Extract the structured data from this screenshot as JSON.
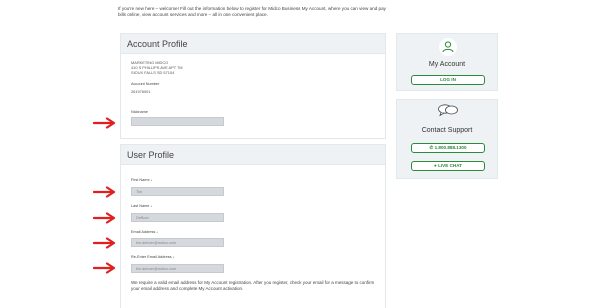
{
  "intro": "If you're new here – welcome! Fill out the information below to register for Midco Business My Account, where you can view and pay bills online, view account services and more – all in one convenient place.",
  "account_profile": {
    "title": "Account Profile",
    "address_lines": [
      "MARKETING MIDCO",
      "410 S PHILLIPS AVE APT 7M",
      "SIOUX FALLS SD 57104"
    ],
    "account_number_label": "Account Number",
    "account_number": "261976001",
    "nickname_label": "Nickname",
    "nickname_value": ""
  },
  "user_profile": {
    "title": "User Profile",
    "fields": [
      {
        "label": "First Name",
        "value": "Tim"
      },
      {
        "label": "Last Name",
        "value": "DeBoer"
      },
      {
        "label": "Email Address",
        "value": "tim.deboer@midco.com"
      },
      {
        "label": "Re-Enter Email Address",
        "value": "tim.deboer@midco.com"
      }
    ],
    "required_mark": "*",
    "note": "We require a valid email address for My Account registration. After you register, check your email for a message to confirm your email address and complete My Account activation."
  },
  "my_account": {
    "title": "My Account",
    "login_label": "LOG IN",
    "icon": "user-icon"
  },
  "support": {
    "title": "Contact Support",
    "phone_label": "1.800.888.1300",
    "chat_label": "LIVE CHAT",
    "icon": "chat-bubbles-icon"
  },
  "colors": {
    "accent_green": "#2c8a3c",
    "arrow_red": "#e02020",
    "panel_header": "#eef2f5",
    "field_bg": "#d5d9dd"
  }
}
